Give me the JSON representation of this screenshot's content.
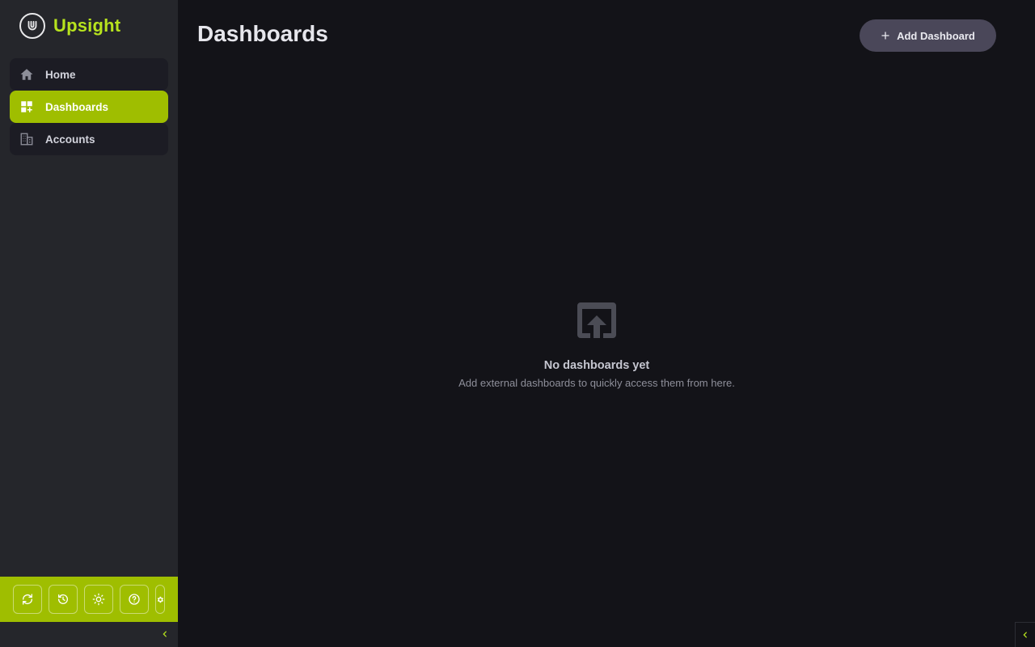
{
  "app": {
    "name": "Upsight",
    "accent_color": "#9fbe00",
    "logo_text_color": "#b7e31e"
  },
  "sidebar": {
    "items": [
      {
        "label": "Home",
        "icon": "home-icon",
        "active": false
      },
      {
        "label": "Dashboards",
        "icon": "dashboard-icon",
        "active": true
      },
      {
        "label": "Accounts",
        "icon": "building-icon",
        "active": false
      }
    ],
    "bottom_icons": [
      "sync-icon",
      "history-icon",
      "sun-icon",
      "help-icon",
      "gear-icon"
    ]
  },
  "main": {
    "title": "Dashboards",
    "add_button_label": "Add Dashboard",
    "empty_state": {
      "icon": "open-in-new-icon",
      "title": "No dashboards yet",
      "subtitle": "Add external dashboards to quickly access them from here."
    }
  }
}
